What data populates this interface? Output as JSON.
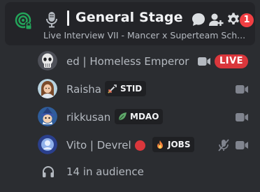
{
  "header": {
    "title": "General Stage",
    "subtitle": "Live Interview VII - Mancer x Superteam Sch...",
    "notification_count": "1"
  },
  "colors": {
    "accent_green": "#23a55a",
    "live_red": "#da373c",
    "badge_red": "#f23f43",
    "speaking_red": "#da373c"
  },
  "speakers": [
    {
      "name": "ed | Homeless Emperor",
      "live_label": "LIVE"
    },
    {
      "name": "Raisha",
      "tag": "STID"
    },
    {
      "name": "rikkusan",
      "tag": "MDAO"
    },
    {
      "name": "Vito | Devrel",
      "tag": "JOBS"
    }
  ],
  "audience": {
    "label": "14 in audience"
  }
}
